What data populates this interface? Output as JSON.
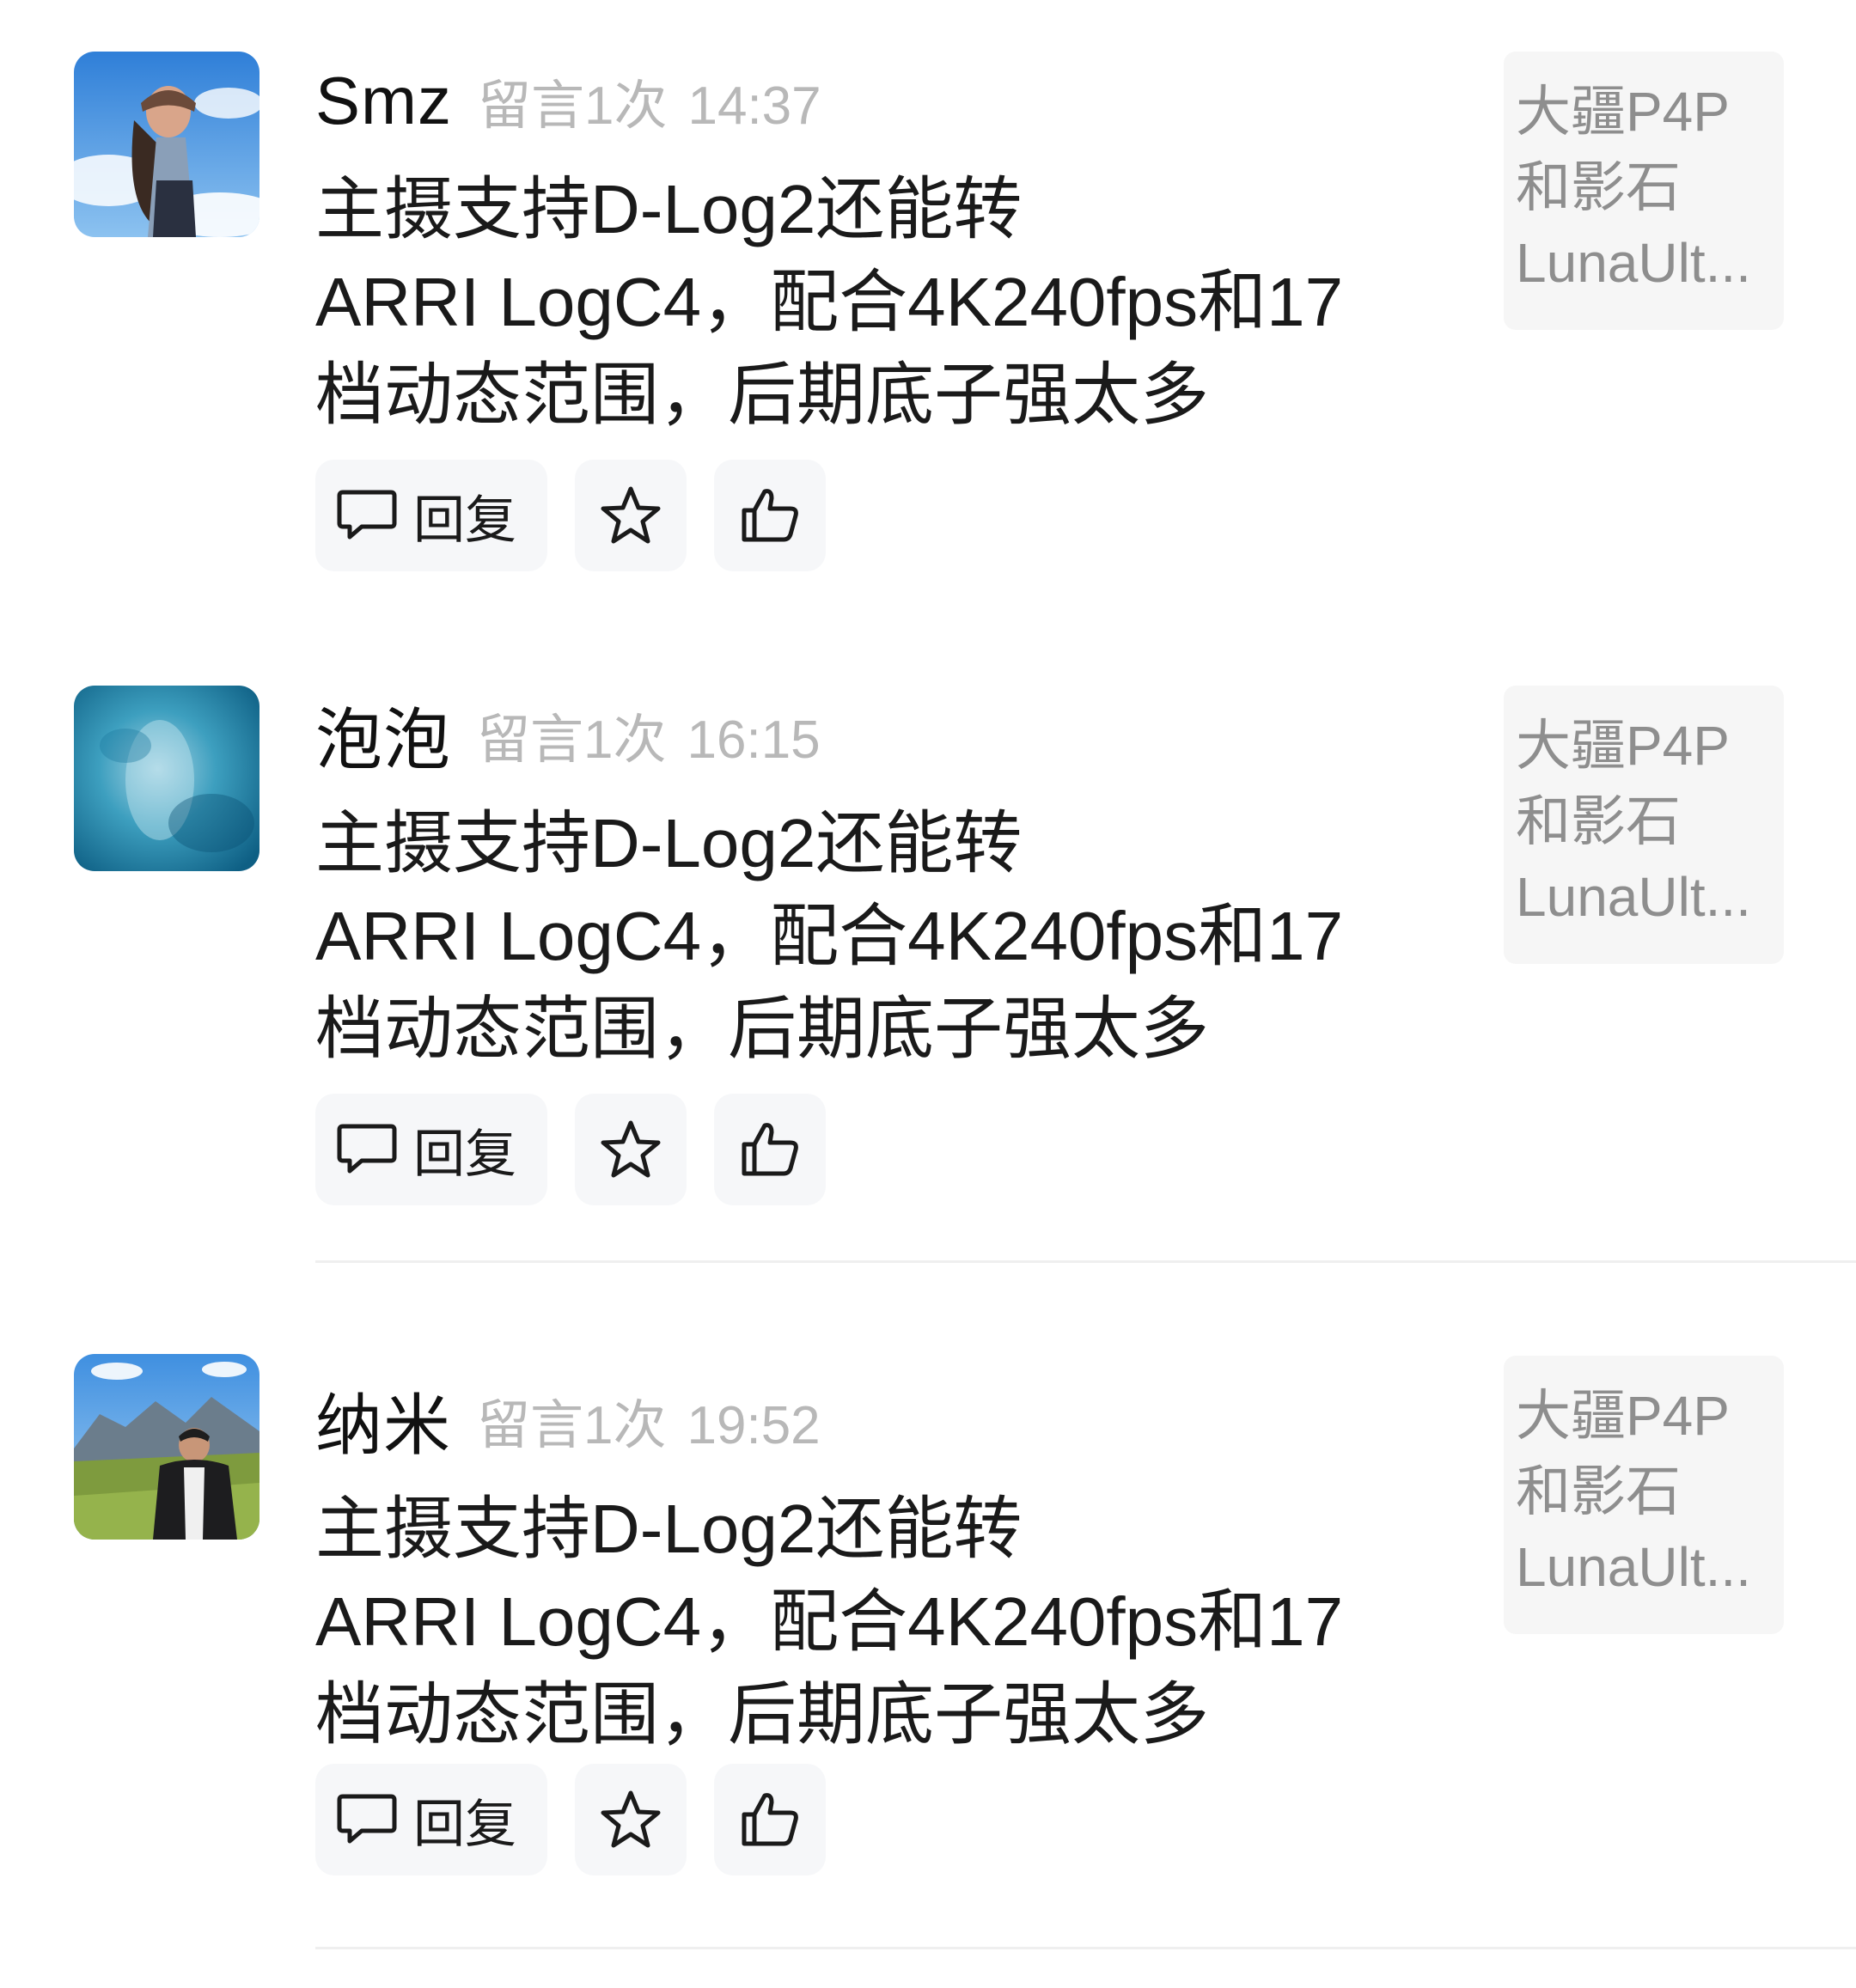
{
  "comments": [
    {
      "username": "Smz",
      "meta_label": "留言1次",
      "time": "14:37",
      "avatar_icon": "avatar-photo-icon",
      "content_lines": [
        "主摄支持D-Log2还能转",
        "ARRI LogC4，配合4K240fps和17",
        "档动态范围，后期底子强太多"
      ],
      "reply_label": "回复",
      "quote_lines": [
        "大疆P4P",
        "和影石",
        "LunaUlt..."
      ]
    },
    {
      "username": "泡泡",
      "meta_label": "留言1次",
      "time": "16:15",
      "avatar_icon": "avatar-photo-icon",
      "content_lines": [
        "主摄支持D-Log2还能转",
        "ARRI LogC4，配合4K240fps和17",
        "档动态范围，后期底子强太多"
      ],
      "reply_label": "回复",
      "quote_lines": [
        "大疆P4P",
        "和影石",
        "LunaUlt..."
      ]
    },
    {
      "username": "纳米",
      "meta_label": "留言1次",
      "time": "19:52",
      "avatar_icon": "avatar-photo-icon",
      "content_lines": [
        "主摄支持D-Log2还能转",
        "ARRI LogC4，配合4K240fps和17",
        "档动态范围，后期底子强太多"
      ],
      "reply_label": "回复",
      "quote_lines": [
        "大疆P4P",
        "和影石",
        "LunaUlt..."
      ]
    }
  ],
  "icons": {
    "reply": "speech-bubble-icon",
    "favorite": "star-icon",
    "like": "thumbs-up-icon"
  },
  "colors": {
    "background": "#ffffff",
    "button_bg": "#f6f7f9",
    "meta_text": "#b8b8b8",
    "quote_bg": "#f6f6f6",
    "quote_text": "#8e8e8e"
  }
}
